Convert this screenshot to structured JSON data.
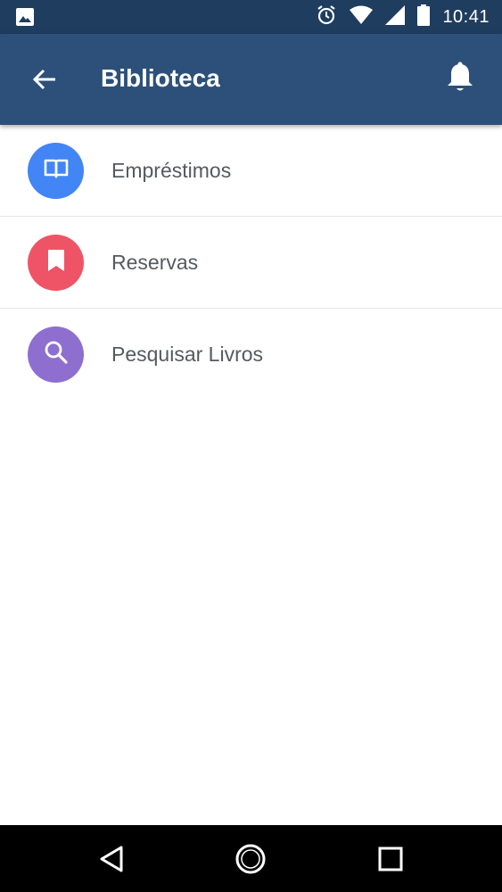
{
  "status_bar": {
    "time": "10:41",
    "icons": [
      "image-notification-icon",
      "alarm-icon",
      "wifi-icon",
      "signal-icon",
      "battery-icon"
    ]
  },
  "app_bar": {
    "title": "Biblioteca",
    "back_icon": "arrow-left-icon",
    "notification_icon": "bell-icon",
    "background_color": "#2c5079"
  },
  "menu": {
    "items": [
      {
        "label": "Empréstimos",
        "icon": "open-book-icon",
        "color": "#4285f4"
      },
      {
        "label": "Reservas",
        "icon": "bookmark-icon",
        "color": "#ef5466"
      },
      {
        "label": "Pesquisar Livros",
        "icon": "search-icon",
        "color": "#8e6fcf"
      }
    ]
  },
  "nav_bar": {
    "buttons": [
      "back-triangle-icon",
      "home-circle-icon",
      "recents-square-icon"
    ]
  }
}
